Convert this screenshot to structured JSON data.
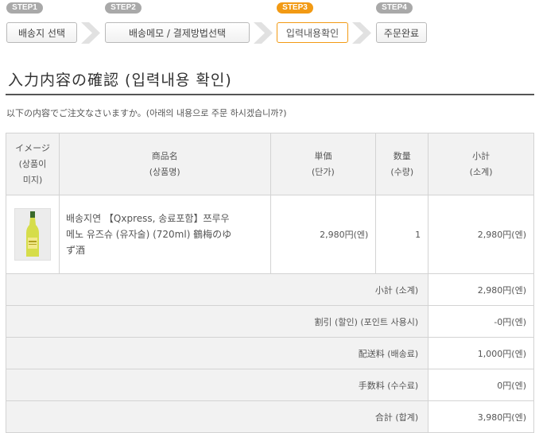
{
  "steps": [
    {
      "tag": "STEP1",
      "label": "배송지 선택"
    },
    {
      "tag": "STEP2",
      "label": "배송메모 / 결제방법선택"
    },
    {
      "tag": "STEP3",
      "label": "입력내용확인"
    },
    {
      "tag": "STEP4",
      "label": "주문완료"
    }
  ],
  "active_step": "STEP3",
  "heading": "入力内容の確認 (입력내용 확인)",
  "description": "以下の内容でご注文なさいますか。(아래의 내용으로 주문 하시겠습니까?)",
  "table": {
    "headers": {
      "image": [
        "イメージ",
        "(상품이",
        "미지)"
      ],
      "name": [
        "商品名",
        "(상품명)"
      ],
      "price": [
        "単価",
        "(단가)"
      ],
      "qty": [
        "数量",
        "(수량)"
      ],
      "subtotal": [
        "小計",
        "(소계)"
      ]
    },
    "item": {
      "name_lines": [
        "배송지연 【Qxpress, 송료포함】쯔루우",
        "메노 유즈슈 (유자술) (720ml) 鶴梅のゆ",
        "ず酒"
      ],
      "image_icon": "yuzu-liqueur-bottle-icon",
      "price": "2,980円(엔)",
      "qty": "1",
      "subtotal": "2,980円(엔)"
    },
    "summary": [
      {
        "label": "小計 (소계)",
        "value": "2,980円(엔)"
      },
      {
        "label": "割引 (할인) (포인트 사용시)",
        "value": "-0円(엔)"
      },
      {
        "label": "配送料 (배송료)",
        "value": "1,000円(엔)"
      },
      {
        "label": "手数料 (수수료)",
        "value": "0円(엔)"
      },
      {
        "label": "合計 (합계)",
        "value": "3,980円(엔)"
      }
    ]
  },
  "colors": {
    "active": "#f29a14",
    "inactive": "#a9a9a9",
    "header_bg": "#f2f2f2"
  }
}
